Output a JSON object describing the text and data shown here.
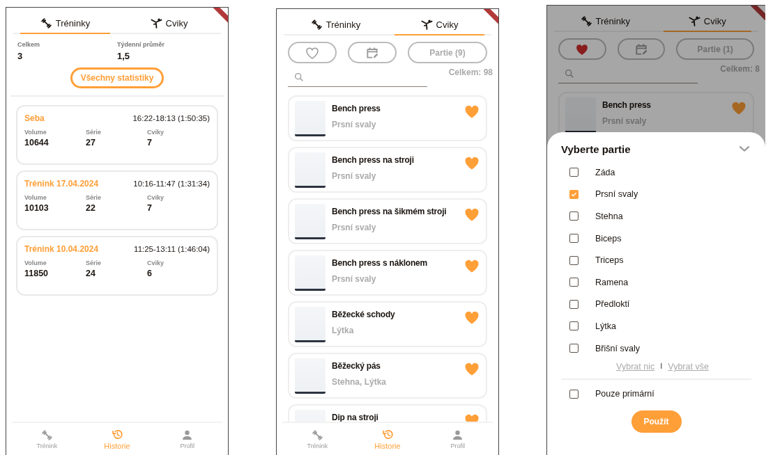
{
  "screens": [
    {
      "kind": "history",
      "tabs": [
        {
          "label": "Tréninky",
          "selected": true
        },
        {
          "label": "Cviky",
          "selected": false
        }
      ],
      "stats": [
        {
          "label": "Celkem",
          "value": "3"
        },
        {
          "label": "Týdenní průměr",
          "value": "1,5"
        }
      ],
      "stats_button": "Všechny statistiky",
      "workouts": [
        {
          "title": "Seba",
          "time": "16:22-18:13 (1:50:35)",
          "metrics": [
            {
              "label": "Volume",
              "value": "10644"
            },
            {
              "label": "Série",
              "value": "27"
            },
            {
              "label": "Cviky",
              "value": "7"
            }
          ]
        },
        {
          "title": "Trénink 17.04.2024",
          "time": "10:16-11:47 (1:31:34)",
          "metrics": [
            {
              "label": "Volume",
              "value": "10103"
            },
            {
              "label": "Série",
              "value": "22"
            },
            {
              "label": "Cviky",
              "value": "7"
            }
          ]
        },
        {
          "title": "Trénink 10.04.2024",
          "time": "11:25-13:11 (1:46:04)",
          "metrics": [
            {
              "label": "Volume",
              "value": "11850"
            },
            {
              "label": "Série",
              "value": "24"
            },
            {
              "label": "Cviky",
              "value": "6"
            }
          ]
        }
      ],
      "nav": [
        {
          "label": "Trénink",
          "selected": false
        },
        {
          "label": "Historie",
          "selected": true
        },
        {
          "label": "Profil",
          "selected": false
        }
      ]
    },
    {
      "kind": "exercises",
      "tabs": [
        {
          "label": "Tréninky",
          "selected": false
        },
        {
          "label": "Cviky",
          "selected": true
        }
      ],
      "favorites_only": false,
      "parts_button": "Partie (9)",
      "total": "Celkem: 98",
      "exercises": [
        {
          "name": "Bench press",
          "muscles": "Prsní svaly",
          "favorite": true
        },
        {
          "name": "Bench press na stroji",
          "muscles": "Prsní svaly",
          "favorite": true
        },
        {
          "name": "Bench press na šikmém stroji",
          "muscles": "Prsní svaly",
          "favorite": true
        },
        {
          "name": "Bench press s náklonem",
          "muscles": "Prsní svaly",
          "favorite": true
        },
        {
          "name": "Běžecké schody",
          "muscles": "Lýtka",
          "favorite": true
        },
        {
          "name": "Běžecký pás",
          "muscles": "Stehna, Lýtka",
          "favorite": true
        },
        {
          "name": "Dip na stroji",
          "favorite": true
        }
      ],
      "nav": [
        {
          "label": "Trénink",
          "selected": false
        },
        {
          "label": "Historie",
          "selected": true
        },
        {
          "label": "Profil",
          "selected": false
        }
      ]
    },
    {
      "kind": "exercises",
      "tabs": [
        {
          "label": "Tréninky",
          "selected": false
        },
        {
          "label": "Cviky",
          "selected": true
        }
      ],
      "favorites_only": true,
      "parts_button": "Partie (1)",
      "total": "Celkem: 8",
      "exercises": [
        {
          "name": "Bench press",
          "muscles": "Prsní svaly",
          "favorite": true
        }
      ],
      "sheet": {
        "title": "Vyberte partie",
        "options": [
          {
            "label": "Záda",
            "checked": false
          },
          {
            "label": "Prsní svaly",
            "checked": true
          },
          {
            "label": "Stehna",
            "checked": false
          },
          {
            "label": "Biceps",
            "checked": false
          },
          {
            "label": "Triceps",
            "checked": false
          },
          {
            "label": "Ramena",
            "checked": false
          },
          {
            "label": "Předloktí",
            "checked": false
          },
          {
            "label": "Lýtka",
            "checked": false
          },
          {
            "label": "Břišní svaly",
            "checked": false
          }
        ],
        "select_none": "Vybrat nic",
        "separator": "I",
        "select_all": "Vybrat vše",
        "primary_only": {
          "label": "Pouze primární",
          "checked": false
        },
        "apply": "Použít"
      }
    }
  ]
}
